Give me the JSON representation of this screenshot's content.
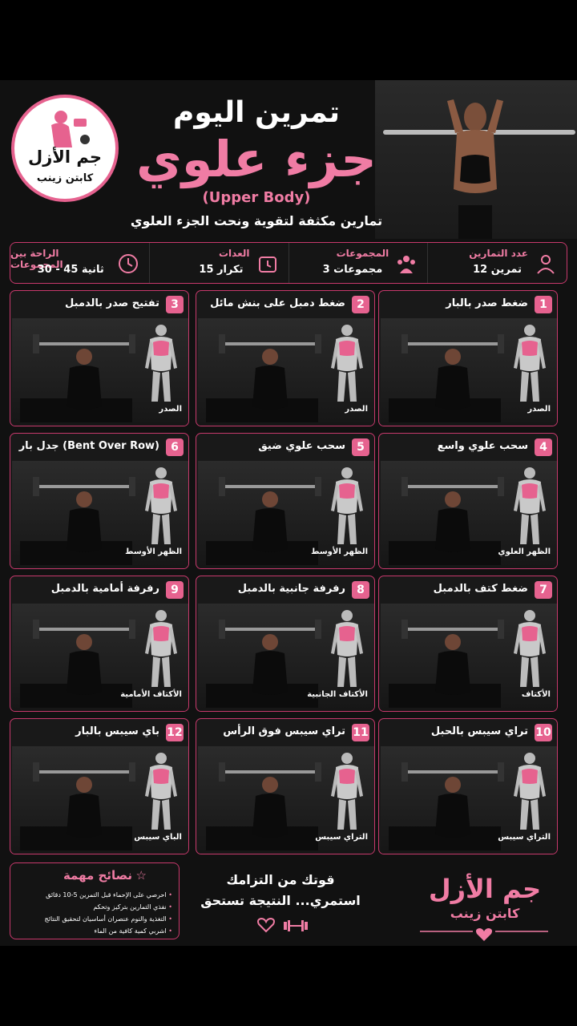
{
  "header": {
    "title_top": "تمرين اليوم",
    "title_main": "جزء علوي",
    "title_en": "(Upper Body)",
    "tagline": "تمارين مكثفة لتقوية ونحت الجزء العلوي",
    "logo_name": "جم الأزل",
    "logo_sub": "كابتن زينب"
  },
  "stats": [
    {
      "label": "عدد التمارين",
      "value": "12 تمرين",
      "icon": "person-icon"
    },
    {
      "label": "المجموعات",
      "value": "3 مجموعات",
      "icon": "group-icon"
    },
    {
      "label": "العدات",
      "value": "15 تكرار",
      "icon": "timer-icon"
    },
    {
      "label": "الراحة بين المجموعات",
      "value": "30 - 45 ثانية",
      "icon": "clock-icon"
    }
  ],
  "exercises": [
    {
      "num": "1",
      "name": "ضغط صدر بالبار",
      "muscle": "الصدر"
    },
    {
      "num": "2",
      "name": "ضغط دمبل على بنش مائل",
      "muscle": "الصدر"
    },
    {
      "num": "3",
      "name": "تفتيح صدر بالدمبل",
      "muscle": "الصدر"
    },
    {
      "num": "4",
      "name": "سحب علوي واسع",
      "muscle": "الظهر العلوي"
    },
    {
      "num": "5",
      "name": "سحب علوي ضيق",
      "muscle": "الظهر الأوسط"
    },
    {
      "num": "6",
      "name": "جدل بار (Bent Over Row)",
      "muscle": "الظهر الأوسط"
    },
    {
      "num": "7",
      "name": "ضغط كتف بالدمبل",
      "muscle": "الأكتاف"
    },
    {
      "num": "8",
      "name": "رفرفة جانبية بالدمبل",
      "muscle": "الأكتاف الجانبية"
    },
    {
      "num": "9",
      "name": "رفرفة أمامية بالدمبل",
      "muscle": "الأكتاف الأمامية"
    },
    {
      "num": "10",
      "name": "تراي سيبس بالحبل",
      "muscle": "التراي سيبس"
    },
    {
      "num": "11",
      "name": "تراي سيبس فوق الرأس",
      "muscle": "التراي سيبس"
    },
    {
      "num": "12",
      "name": "باي سيبس بالبار",
      "muscle": "الباي سيبس"
    }
  ],
  "tips": {
    "title": "نصائح مهمة",
    "items": [
      "احرصي على الإحماء قبل التمرين 5-10 دقائق",
      "نفذي التمارين بتركيز وتحكم",
      "التغذية والنوم عنصران أساسيان لتحقيق النتائج",
      "اشربي كمية كافية من الماء"
    ]
  },
  "motto": {
    "line1": "قوتك من التزامك",
    "line2": "استمري... النتيجة تستحق"
  },
  "brand": {
    "name": "جم الأزل",
    "sub": "كابتن زينب"
  },
  "colors": {
    "accent": "#e6628f",
    "background": "#111111"
  }
}
